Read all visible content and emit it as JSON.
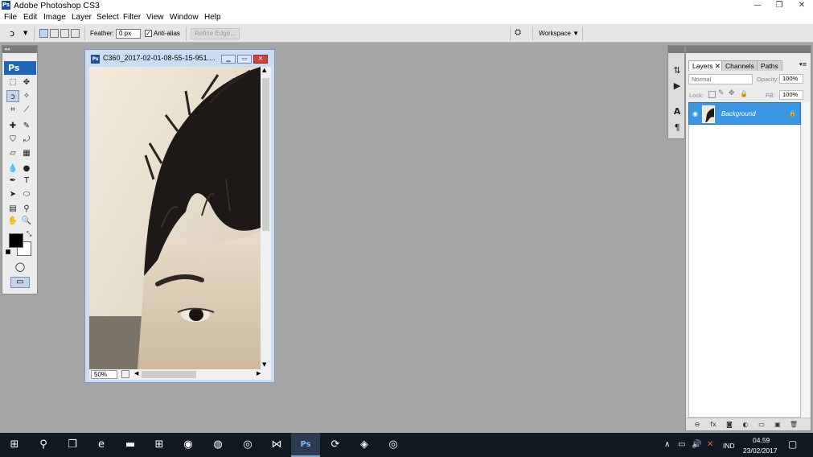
{
  "app": {
    "title": "Adobe Photoshop CS3",
    "logo_text": "Ps"
  },
  "window_controls": {
    "minimize": "—",
    "restore": "❐",
    "close": "✕"
  },
  "menubar": [
    "File",
    "Edit",
    "Image",
    "Layer",
    "Select",
    "Filter",
    "View",
    "Window",
    "Help"
  ],
  "options_bar": {
    "feather_label": "Feather:",
    "feather_value": "0 px",
    "antialias_label": "Anti-alias",
    "antialias_checked": "✓",
    "refine_edge_label": "Refine Edge...",
    "workspace_label": "Workspace ▼"
  },
  "toolbox": {
    "badge": "Ps",
    "collapse_arrows": "◂◂",
    "tools": [
      {
        "name": "marquee-tool-icon",
        "glyph": "⬚"
      },
      {
        "name": "move-tool-icon",
        "glyph": "✥"
      },
      {
        "name": "lasso-tool-icon",
        "glyph": "ↄ"
      },
      {
        "name": "magic-wand-tool-icon",
        "glyph": "✧"
      },
      {
        "name": "crop-tool-icon",
        "glyph": "⌗"
      },
      {
        "name": "slice-tool-icon",
        "glyph": "⟋"
      },
      {
        "name": "healing-brush-tool-icon",
        "glyph": "✚"
      },
      {
        "name": "brush-tool-icon",
        "glyph": "✎"
      },
      {
        "name": "clone-stamp-tool-icon",
        "glyph": "⛉"
      },
      {
        "name": "history-brush-tool-icon",
        "glyph": "⤾"
      },
      {
        "name": "eraser-tool-icon",
        "glyph": "▱"
      },
      {
        "name": "gradient-tool-icon",
        "glyph": "▦"
      },
      {
        "name": "blur-tool-icon",
        "glyph": "💧"
      },
      {
        "name": "dodge-tool-icon",
        "glyph": "●"
      },
      {
        "name": "pen-tool-icon",
        "glyph": "✒"
      },
      {
        "name": "type-tool-icon",
        "glyph": "T"
      },
      {
        "name": "path-selection-tool-icon",
        "glyph": "➤"
      },
      {
        "name": "shape-tool-icon",
        "glyph": "⬭"
      },
      {
        "name": "notes-tool-icon",
        "glyph": "▤"
      },
      {
        "name": "eyedropper-tool-icon",
        "glyph": "⚲"
      },
      {
        "name": "hand-tool-icon",
        "glyph": "✋"
      },
      {
        "name": "zoom-tool-icon",
        "glyph": "🔍"
      }
    ],
    "quick_mask_glyph": "◯",
    "screen_mode_glyph": "▭",
    "swap_glyph": "⤡"
  },
  "document": {
    "icon_text": "Ps",
    "title": "C360_2017-02-01-08-55-15-951....",
    "zoom": "50%",
    "btn_min": "▁",
    "btn_max": "▭",
    "btn_close": "✕",
    "scroll_up": "▲",
    "scroll_down": "▼",
    "scroll_left": "◀",
    "scroll_right": "▶"
  },
  "dock_icons": [
    {
      "name": "history-panel-icon",
      "glyph": "⇅"
    },
    {
      "name": "actions-panel-icon",
      "glyph": "▶"
    },
    {
      "name": "character-panel-icon",
      "glyph": "A"
    },
    {
      "name": "paragraph-panel-icon",
      "glyph": "¶"
    }
  ],
  "layers_panel": {
    "tabs": [
      "Layers ✕",
      "Channels",
      "Paths"
    ],
    "active_tab": 0,
    "blend_mode": "Normal",
    "opacity_label": "Opacity:",
    "opacity_value": "100%",
    "lock_label": "Lock:",
    "fill_label": "Fill:",
    "fill_value": "100%",
    "layer_name": "Background",
    "menu_glyph": "▾≡",
    "footer_icons": [
      {
        "name": "link-layers-icon",
        "glyph": "⊖"
      },
      {
        "name": "layer-style-icon",
        "glyph": "fx"
      },
      {
        "name": "layer-mask-icon",
        "glyph": "◙"
      },
      {
        "name": "adjustment-layer-icon",
        "glyph": "◐"
      },
      {
        "name": "new-group-icon",
        "glyph": "▭"
      },
      {
        "name": "new-layer-icon",
        "glyph": "▣"
      },
      {
        "name": "delete-layer-icon",
        "glyph": "🗑"
      }
    ]
  },
  "taskbar": {
    "items": [
      {
        "name": "start-button",
        "glyph": "⊞"
      },
      {
        "name": "search-icon",
        "glyph": "⚲"
      },
      {
        "name": "task-view-icon",
        "glyph": "❐"
      },
      {
        "name": "edge-icon",
        "glyph": "e"
      },
      {
        "name": "file-explorer-icon",
        "glyph": "▬"
      },
      {
        "name": "store-icon",
        "glyph": "⊞"
      },
      {
        "name": "chrome-icon",
        "glyph": "◉"
      },
      {
        "name": "firefox-icon",
        "glyph": "◍"
      },
      {
        "name": "media-app-icon",
        "glyph": "◎"
      },
      {
        "name": "visual-studio-icon",
        "glyph": "⋈"
      },
      {
        "name": "photoshop-taskbar-icon",
        "glyph": "Ps"
      },
      {
        "name": "sync-app-icon",
        "glyph": "⟳"
      },
      {
        "name": "app-icon",
        "glyph": "◈"
      },
      {
        "name": "target-app-icon",
        "glyph": "◎"
      }
    ],
    "tray": {
      "chevron": "∧",
      "battery": "▭",
      "volume": "🔊",
      "network": "✕",
      "lang": "IND",
      "time": "04.59",
      "date": "23/02/2017",
      "notification": "▢"
    }
  }
}
